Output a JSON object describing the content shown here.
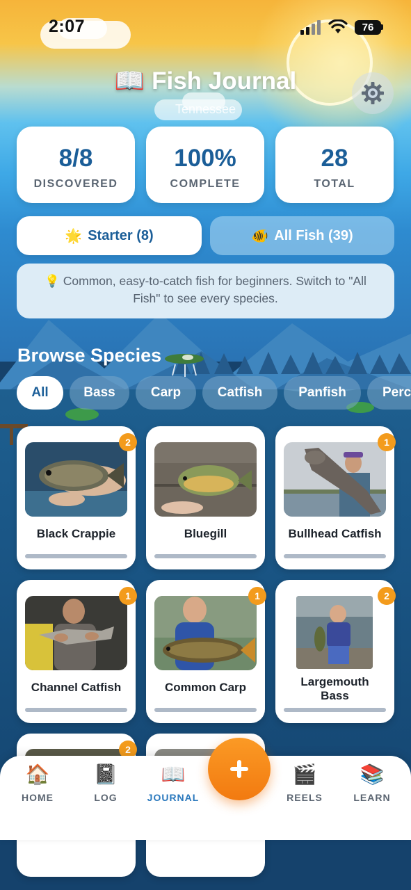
{
  "status_bar": {
    "time": "2:07",
    "battery": "76"
  },
  "header": {
    "title_icon": "📖",
    "title": "Fish Journal",
    "subtitle": "Tennessee",
    "settings_icon": "gear-icon"
  },
  "stats": [
    {
      "value": "8/8",
      "label": "DISCOVERED"
    },
    {
      "value": "100%",
      "label": "COMPLETE"
    },
    {
      "value": "28",
      "label": "TOTAL"
    }
  ],
  "mode_toggle": {
    "starter": {
      "icon": "🌟",
      "label": "Starter (8)"
    },
    "all": {
      "icon": "🐠",
      "label": "All Fish (39)"
    }
  },
  "tip": {
    "icon": "💡",
    "text": "Common, easy-to-catch fish for beginners. Switch to \"All Fish\" to see every species."
  },
  "browse": {
    "title": "Browse Species",
    "filters": [
      "All",
      "Bass",
      "Carp",
      "Catfish",
      "Panfish",
      "Perc"
    ],
    "selected_filter": "All"
  },
  "fish": [
    {
      "name": "Black Crappie",
      "badge": "2"
    },
    {
      "name": "Bluegill",
      "badge": ""
    },
    {
      "name": "Bullhead Catfish",
      "badge": "1"
    },
    {
      "name": "Channel Catfish",
      "badge": "1"
    },
    {
      "name": "Common Carp",
      "badge": "1"
    },
    {
      "name": "Largemouth Bass",
      "badge": "2"
    },
    {
      "name": "",
      "badge": "2"
    },
    {
      "name": "",
      "badge": ""
    }
  ],
  "bottom_nav": [
    {
      "label": "HOME",
      "icon": "🏠"
    },
    {
      "label": "LOG",
      "icon": "📓"
    },
    {
      "label": "JOURNAL",
      "icon": "📖"
    },
    {
      "label": "REELS",
      "icon": "🎬"
    },
    {
      "label": "LEARN",
      "icon": "📚"
    }
  ],
  "fab": {
    "icon": "plus-icon"
  },
  "colors": {
    "accent": "#1b5e98",
    "orange": "#f39b1c",
    "fab": "#f5831a",
    "nav_active": "#2a78bd"
  }
}
